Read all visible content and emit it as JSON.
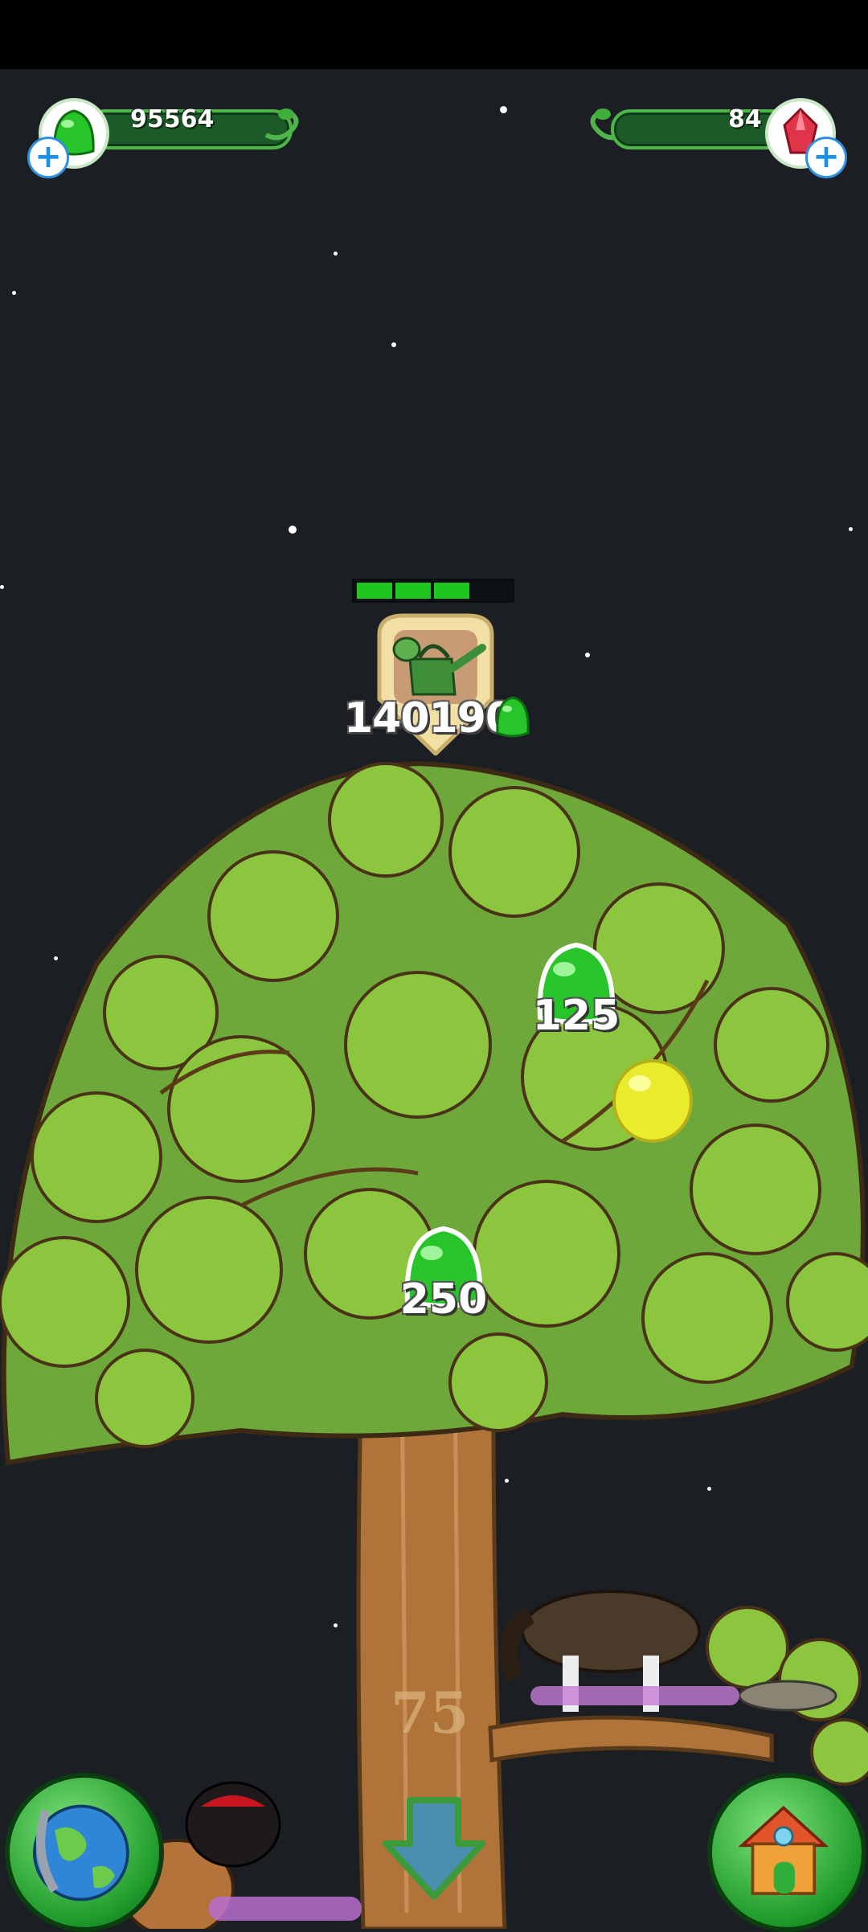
{
  "hud": {
    "gumdrops": "95564",
    "gems": "84"
  },
  "task": {
    "progress": 0.75,
    "cost": "140190",
    "icon": "watering-can-icon"
  },
  "pickups": [
    {
      "value": "125",
      "icon": "gumdrop-icon"
    },
    {
      "value": "250",
      "icon": "gumdrop-icon"
    }
  ],
  "tree": {
    "level": "75"
  },
  "buttons": {
    "map": "globe-icon",
    "home": "house-icon",
    "down": "down-arrow-icon"
  },
  "colors": {
    "background": "#1b1f24",
    "accent_green": "#1ec71f",
    "leaf": "#8cc63f",
    "bark": "#b0743b",
    "gem_red": "#e0344a",
    "plus_blue": "#1a8fe8"
  }
}
